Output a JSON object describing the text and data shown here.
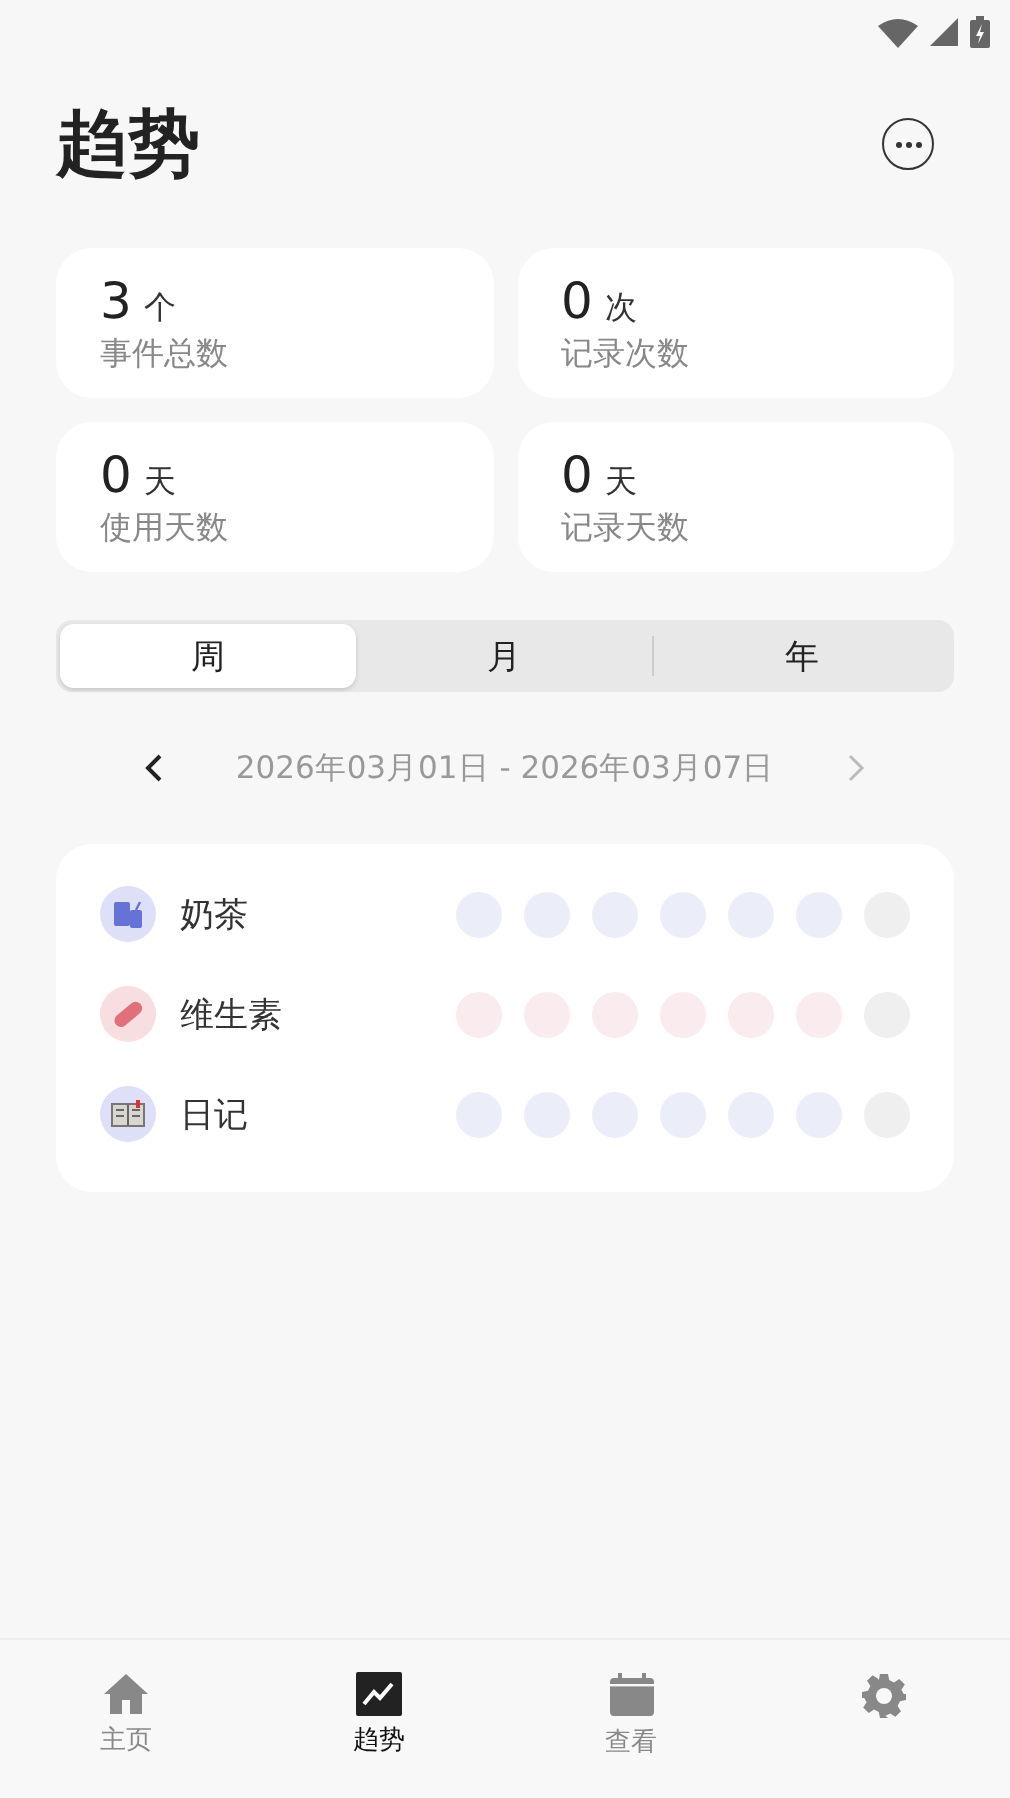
{
  "header": {
    "title": "趋势"
  },
  "stats": [
    {
      "value": "3",
      "unit": "个",
      "label": "事件总数"
    },
    {
      "value": "0",
      "unit": "次",
      "label": "记录次数"
    },
    {
      "value": "0",
      "unit": "天",
      "label": "使用天数"
    },
    {
      "value": "0",
      "unit": "天",
      "label": "记录天数"
    }
  ],
  "periods": [
    {
      "label": "周",
      "selected": true
    },
    {
      "label": "月",
      "selected": false
    },
    {
      "label": "年",
      "selected": false
    }
  ],
  "range": {
    "text": "2026年03月01日 - 2026年03月07日",
    "next_disabled": true
  },
  "events": [
    {
      "name": "奶茶",
      "kind": "drink",
      "color": "#dde0f6",
      "days": [
        {
          "color": "#ebedf9"
        },
        {
          "color": "#ebedf9"
        },
        {
          "color": "#ebedf9"
        },
        {
          "color": "#ebedf9"
        },
        {
          "color": "#ebedf9"
        },
        {
          "color": "#ebedf9"
        },
        {
          "color": "#efefef"
        }
      ]
    },
    {
      "name": "维生素",
      "kind": "pill",
      "color": "#f8dde1",
      "days": [
        {
          "color": "#f9ebee"
        },
        {
          "color": "#f9ebee"
        },
        {
          "color": "#f9ebee"
        },
        {
          "color": "#f9ebee"
        },
        {
          "color": "#f9ebee"
        },
        {
          "color": "#f9ebee"
        },
        {
          "color": "#efefef"
        }
      ]
    },
    {
      "name": "日记",
      "kind": "book",
      "color": "#dde0f6",
      "days": [
        {
          "color": "#ebedf9"
        },
        {
          "color": "#ebedf9"
        },
        {
          "color": "#ebedf9"
        },
        {
          "color": "#ebedf9"
        },
        {
          "color": "#ebedf9"
        },
        {
          "color": "#ebedf9"
        },
        {
          "color": "#efefef"
        }
      ]
    }
  ],
  "nav": [
    {
      "kind": "home",
      "label": "主页",
      "selected": false
    },
    {
      "kind": "trend",
      "label": "趋势",
      "selected": true
    },
    {
      "kind": "calendar",
      "label": "查看",
      "selected": false
    },
    {
      "kind": "settings",
      "selected": false
    }
  ]
}
